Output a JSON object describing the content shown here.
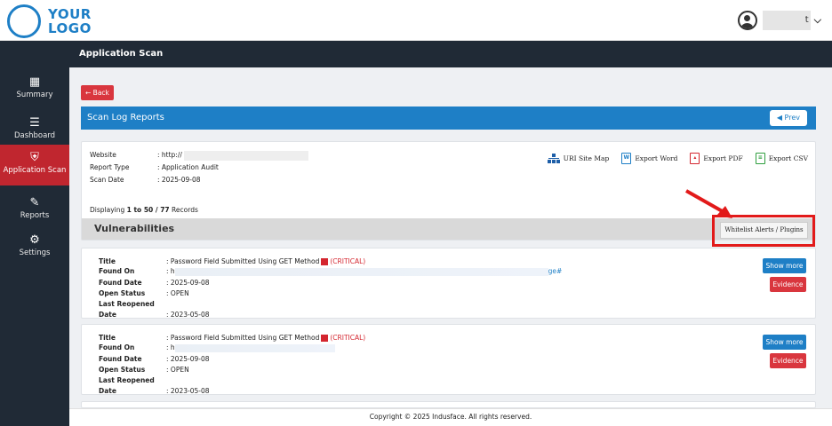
{
  "header": {
    "logo_line1": "YOUR",
    "logo_line2": "LOGO",
    "user_name_suffix": "t",
    "user_caret": "⌄"
  },
  "sidebar": {
    "items": [
      {
        "label": "Summary",
        "icon": "summary-icon",
        "active": false
      },
      {
        "label": "Dashboard",
        "icon": "dashboard-icon",
        "active": false
      },
      {
        "label": "Application Scan",
        "icon": "shield-icon",
        "active": true
      },
      {
        "label": "Reports",
        "icon": "edit-icon",
        "active": false
      },
      {
        "label": "Settings",
        "icon": "gear-icon",
        "active": false
      }
    ]
  },
  "title_bar": {
    "title": "Application Scan"
  },
  "main": {
    "back_label": "← Back",
    "section_title": "Scan Log Reports",
    "prev_label": "◀ Prev",
    "info": {
      "website_key": "Website",
      "website_value": ": http://",
      "report_type_key": "Report Type",
      "report_type_value": ": Application Audit",
      "scan_date_key": "Scan Date",
      "scan_date_value": ": 2025-09-08"
    },
    "exports": {
      "sitemap": "URI Site Map",
      "word": "Export Word",
      "pdf": "Export PDF",
      "csv": "Export CSV"
    },
    "displaying": {
      "prefix": "Displaying ",
      "range": "1 to 50 / 77",
      "suffix": " Records"
    },
    "vulnerabilities_title": "Vulnerabilities",
    "whitelist_label": "Whitelist Alerts / Plugins",
    "vulns": [
      {
        "title_key": "Title",
        "title_value": ": Password Field Submitted Using GET Method",
        "severity": "(CRITICAL)",
        "found_on_key": "Found On",
        "found_on_value": ": h",
        "found_on_tail": "ge#",
        "found_date_key": "Found Date",
        "found_date_value": ": 2025-09-08",
        "open_status_key": "Open Status",
        "open_status_value": ": OPEN",
        "reopened_key": "Last Reopened Date",
        "reopened_value": ": 2023-05-08",
        "show_more": "Show more",
        "evidence": "Evidence"
      },
      {
        "title_key": "Title",
        "title_value": ": Password Field Submitted Using GET Method",
        "severity": "(CRITICAL)",
        "found_on_key": "Found On",
        "found_on_value": ": h",
        "found_on_tail": "",
        "found_date_key": "Found Date",
        "found_date_value": ": 2025-09-08",
        "open_status_key": "Open Status",
        "open_status_value": ": OPEN",
        "reopened_key": "Last Reopened Date",
        "reopened_value": ": 2023-05-08",
        "show_more": "Show more",
        "evidence": "Evidence"
      }
    ]
  },
  "footer": {
    "text": "Copyright © 2025 Indusface. All rights reserved."
  },
  "colors": {
    "sidebar_bg": "#202a36",
    "active": "#c0262f",
    "accent_blue": "#1e7fc6",
    "danger": "#d9363e",
    "highlight_red": "#e21a1a"
  }
}
